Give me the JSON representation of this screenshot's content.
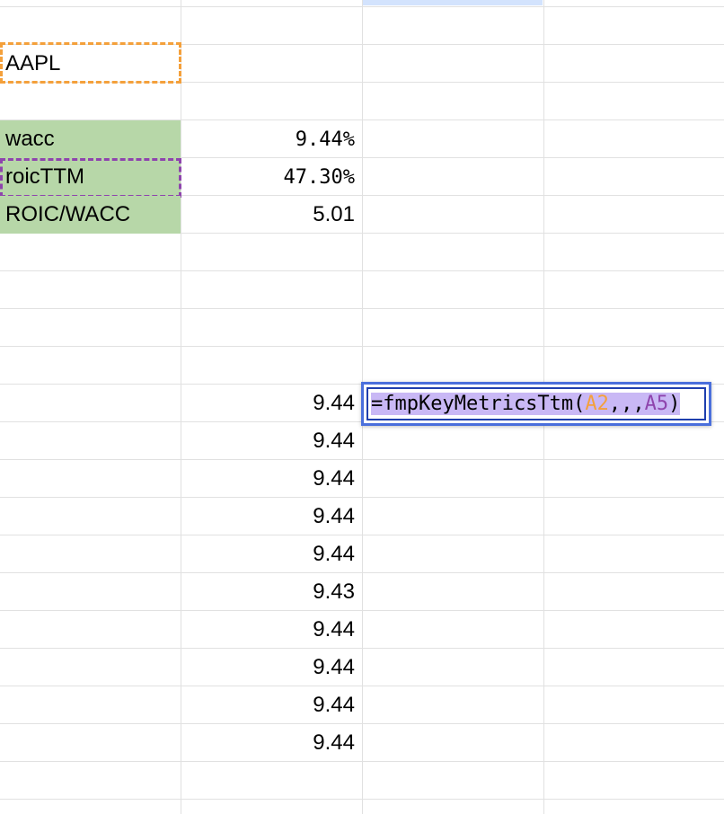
{
  "sheet": {
    "colors": {
      "green_fill": "#b7d7a8",
      "ref_orange": "#f4a03b",
      "ref_purple": "#8e44ad",
      "editor_border": "#4a6fdc"
    },
    "cells": {
      "a2": "AAPL",
      "a4": "wacc",
      "b4": "9.44%",
      "a5": "roicTTM",
      "b5": "47.30%",
      "a6": "ROIC/WACC",
      "b6": "5.01"
    },
    "column_b_values": [
      "9.44",
      "9.44",
      "9.44",
      "9.44",
      "9.44",
      "9.43",
      "9.44",
      "9.44",
      "9.44",
      "9.44"
    ],
    "formula": {
      "prefix": "=fmpKeyMetricsTtm(",
      "ref1": "A2",
      "separators": ",,,",
      "ref2": "A5",
      "suffix": ")"
    }
  }
}
